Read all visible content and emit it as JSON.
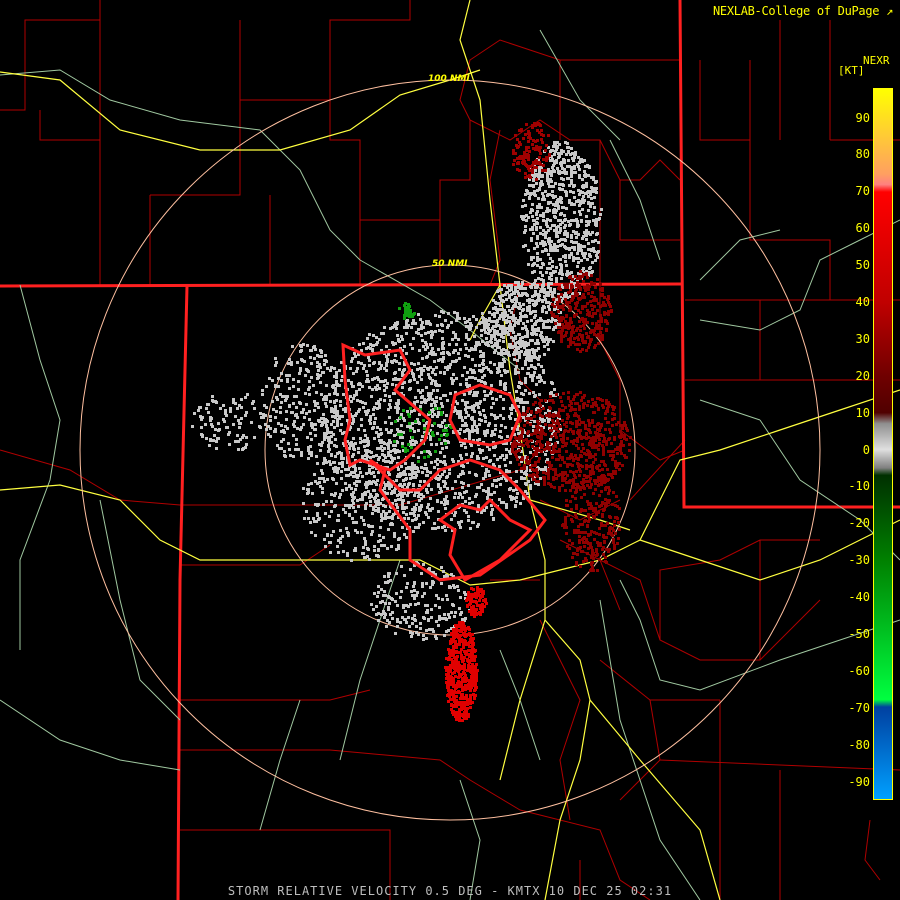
{
  "header": {
    "credit": "NEXLAB-College of DuPage",
    "credit_icon": "external-link-icon",
    "product": "NEXR",
    "unit": "[KT]"
  },
  "range_rings": [
    {
      "label": "100 NMI"
    },
    {
      "label": "50 NMI"
    }
  ],
  "legend": {
    "ticks": [
      {
        "label": "90",
        "value": 90
      },
      {
        "label": "80",
        "value": 80
      },
      {
        "label": "70",
        "value": 70
      },
      {
        "label": "60",
        "value": 60
      },
      {
        "label": "50",
        "value": 50
      },
      {
        "label": "40",
        "value": 40
      },
      {
        "label": "30",
        "value": 30
      },
      {
        "label": "20",
        "value": 20
      },
      {
        "label": "10",
        "value": 10
      },
      {
        "label": "0",
        "value": 0
      },
      {
        "label": "-10",
        "value": -10
      },
      {
        "label": "-20",
        "value": -20
      },
      {
        "label": "-30",
        "value": -30
      },
      {
        "label": "-40",
        "value": -40
      },
      {
        "label": "-50",
        "value": -50
      },
      {
        "label": "-60",
        "value": -60
      },
      {
        "label": "-70",
        "value": -70
      },
      {
        "label": "-80",
        "value": -80
      },
      {
        "label": "-90",
        "value": -90
      }
    ],
    "range": [
      -95,
      98
    ],
    "color_stops": [
      {
        "value": 98,
        "color": "#ffff00"
      },
      {
        "value": 75,
        "color": "#ffa060"
      },
      {
        "value": 72,
        "color": "#ff8080"
      },
      {
        "value": 70,
        "color": "#ff0000"
      },
      {
        "value": 40,
        "color": "#c00000"
      },
      {
        "value": 20,
        "color": "#700000"
      },
      {
        "value": 10,
        "color": "#500000"
      },
      {
        "value": 7,
        "color": "#909090"
      },
      {
        "value": 0,
        "color": "#e0e0e0"
      },
      {
        "value": -5,
        "color": "#808080"
      },
      {
        "value": -7,
        "color": "#003000"
      },
      {
        "value": -30,
        "color": "#008000"
      },
      {
        "value": -68,
        "color": "#00ff40"
      },
      {
        "value": -70,
        "color": "#0040a0"
      },
      {
        "value": -95,
        "color": "#00a0ff"
      }
    ]
  },
  "status_bar": "STORM RELATIVE VELOCITY 0.5 DEG - KMTX 10 DEC 25 02:31",
  "colors": {
    "state_border": "#ff2020",
    "county_border": "#b00000",
    "highway": "#ffff40",
    "road": "#a0c8a0",
    "range_ring": "#ffc0a0",
    "warning_polygon": "#ff2020"
  }
}
